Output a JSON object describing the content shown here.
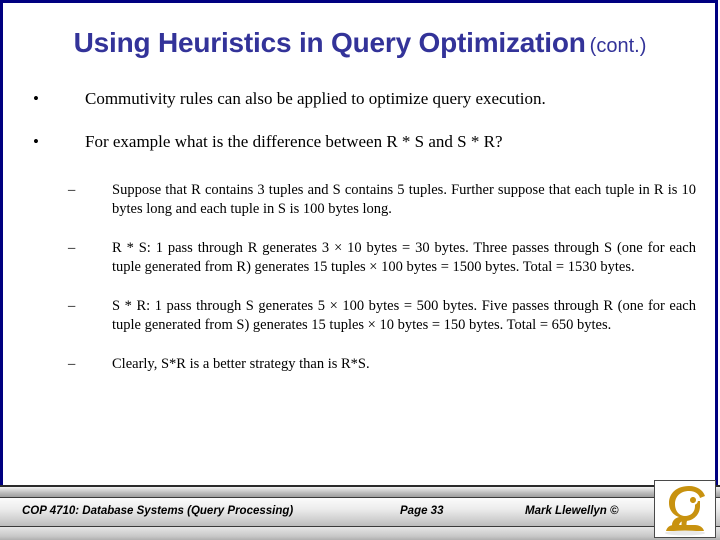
{
  "slide": {
    "title_main": "Using Heuristics in Query Optimization",
    "title_cont": "(cont.)",
    "accent_border_color": "#000080",
    "title_color": "#333399",
    "background_color": "#ffffff",
    "bullets": [
      {
        "marker": "•",
        "level": 1,
        "text": "Commutivity rules can also be applied to optimize query execution."
      },
      {
        "marker": "•",
        "level": 1,
        "text": "For example what is the difference between R * S and S * R?"
      },
      {
        "marker": "–",
        "level": 2,
        "text": "Suppose that R contains 3 tuples and S contains 5 tuples.  Further suppose that each tuple in R is 10 bytes long and each tuple in S is 100 bytes long."
      },
      {
        "marker": "–",
        "level": 2,
        "text": "R * S: 1 pass through R generates 3 × 10 bytes = 30 bytes.  Three passes through S (one for each tuple generated from R) generates 15 tuples × 100 bytes = 1500 bytes.  Total = 1530 bytes."
      },
      {
        "marker": "–",
        "level": 2,
        "text": "S * R: 1 pass through S generates 5 × 100 bytes = 500 bytes.  Five passes through R (one for each tuple generated from S) generates 15 tuples × 10 bytes = 150 bytes.  Total = 650 bytes."
      },
      {
        "marker": "–",
        "level": 2,
        "text": "Clearly, S*R is a better strategy than is R*S."
      }
    ]
  },
  "footer": {
    "course": "COP 4710: Database Systems (Query Processing)",
    "page": "Page 33",
    "author": "Mark Llewellyn ©",
    "logo_name": "ucf-pegasus-logo",
    "logo_color": "#c8920f"
  }
}
